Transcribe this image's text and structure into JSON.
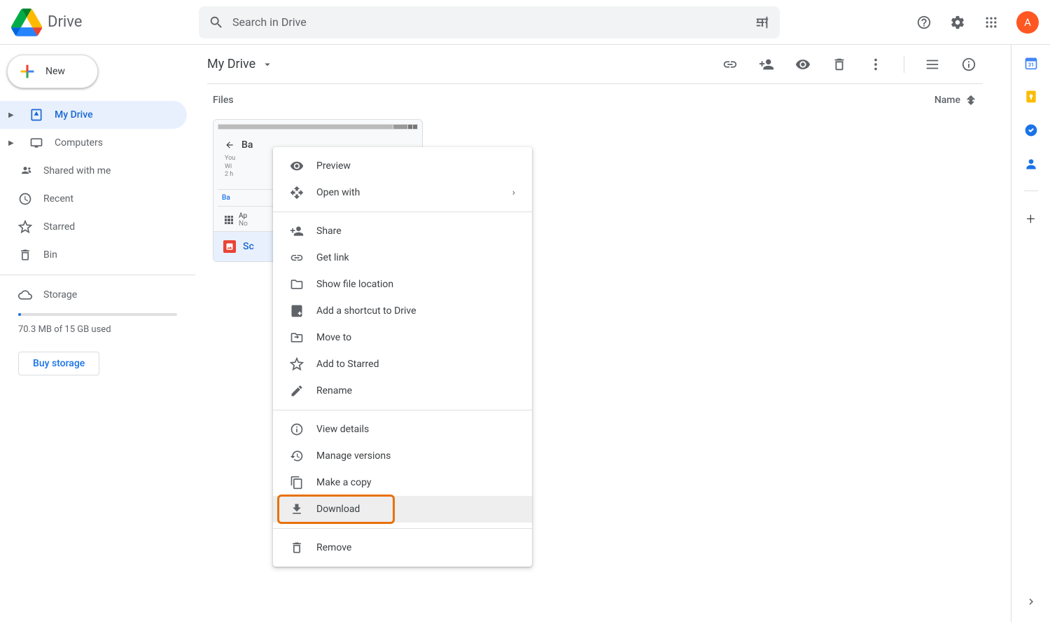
{
  "header": {
    "app_name": "Drive",
    "search_placeholder": "Search in Drive",
    "avatar_initial": "A"
  },
  "sidebar": {
    "new_button": "New",
    "items": [
      {
        "label": "My Drive",
        "expandable": true
      },
      {
        "label": "Computers",
        "expandable": true
      },
      {
        "label": "Shared with me",
        "expandable": false
      },
      {
        "label": "Recent",
        "expandable": false
      },
      {
        "label": "Starred",
        "expandable": false
      },
      {
        "label": "Bin",
        "expandable": false
      }
    ],
    "storage_label": "Storage",
    "storage_used": "70.3 MB of 15 GB used",
    "buy_storage": "Buy storage"
  },
  "content": {
    "breadcrumb": "My Drive",
    "files_label": "Files",
    "sort_label": "Name",
    "file": {
      "thumb_title": "Ba",
      "thumb_line1": "You",
      "thumb_line2": "Wi",
      "thumb_line3": "2 h",
      "thumb_tab1": "Ba",
      "app_label": "Ap",
      "app_sub": "No",
      "footer_name": "Sc"
    }
  },
  "context_menu": {
    "groups": [
      [
        "Preview",
        "Open with"
      ],
      [
        "Share",
        "Get link",
        "Show file location",
        "Add a shortcut to Drive",
        "Move to",
        "Add to Starred",
        "Rename"
      ],
      [
        "View details",
        "Manage versions",
        "Make a copy",
        "Download"
      ],
      [
        "Remove"
      ]
    ],
    "submenu_item": "Open with",
    "highlighted_item": "Download"
  }
}
